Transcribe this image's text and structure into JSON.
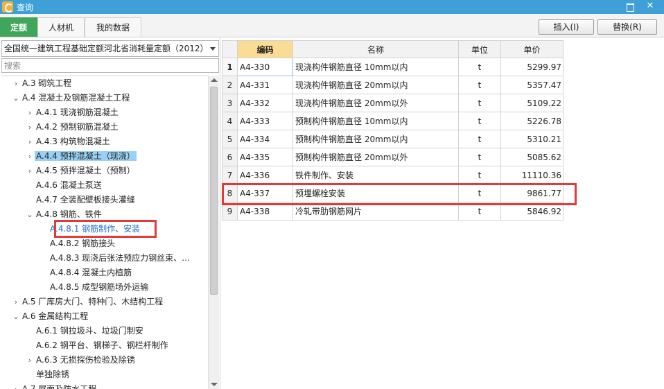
{
  "window": {
    "title": "查询",
    "close_glyph": "✕"
  },
  "tabs": [
    {
      "label": "定额",
      "active": true
    },
    {
      "label": "人材机",
      "active": false
    },
    {
      "label": "我的数据",
      "active": false
    }
  ],
  "actions": {
    "insert_label": "插入(I)",
    "replace_label": "替换(R)"
  },
  "left": {
    "quota_book": "全国统一建筑工程基础定额河北省消耗量定额（2012）",
    "search_placeholder": "搜索",
    "tree": [
      {
        "arrow": "›",
        "label": "A.3 砌筑工程",
        "level": 0
      },
      {
        "arrow": "⌄",
        "label": "A.4 混凝土及钢筋混凝土工程",
        "level": 0
      },
      {
        "arrow": "›",
        "label": "A.4.1 现浇钢筋混凝土",
        "level": 1
      },
      {
        "arrow": "›",
        "label": "A.4.2 预制钢筋混凝土",
        "level": 1
      },
      {
        "arrow": "›",
        "label": "A.4.3 构筑物混凝土",
        "level": 1
      },
      {
        "arrow": "›",
        "label": "A.4.4 预拌混凝土（现浇）",
        "level": 1,
        "selected": true
      },
      {
        "arrow": "›",
        "label": "A.4.5 预拌混凝土（预制）",
        "level": 1
      },
      {
        "arrow": "",
        "label": "A.4.6 混凝土泵送",
        "level": 1
      },
      {
        "arrow": "",
        "label": "A.4.7 全装配壁板接头灌缝",
        "level": 1
      },
      {
        "arrow": "⌄",
        "label": "A.4.8 钢筋、铁件",
        "level": 1
      },
      {
        "arrow": "",
        "label": "A.4.8.1 钢筋制作、安装",
        "level": 2,
        "link": true
      },
      {
        "arrow": "",
        "label": "A.4.8.2 钢筋接头",
        "level": 2
      },
      {
        "arrow": "",
        "label": "A.4.8.3 现浇后张法预应力钢丝束、…",
        "level": 2
      },
      {
        "arrow": "",
        "label": "A.4.8.4 混凝土内植筋",
        "level": 2
      },
      {
        "arrow": "",
        "label": "A.4.8.5 成型钢筋场外运输",
        "level": 2
      },
      {
        "arrow": "›",
        "label": "A.5 厂库房大门、特种门、木结构工程",
        "level": 0
      },
      {
        "arrow": "⌄",
        "label": "A.6 金属结构工程",
        "level": 0
      },
      {
        "arrow": "",
        "label": "A.6.1 钢拉圾斗、垃圾门制安",
        "level": 1
      },
      {
        "arrow": "",
        "label": "A.6.2 钢平台、钢梯子、钢栏杆制作",
        "level": 1
      },
      {
        "arrow": "›",
        "label": "A.6.3 无损探伤检验及除锈",
        "level": 1
      },
      {
        "arrow": "",
        "label": "单独除锈",
        "level": 1
      },
      {
        "arrow": "›",
        "label": "A.7 屋面及防水工程",
        "level": 0
      }
    ]
  },
  "grid": {
    "headers": {
      "rownum": "",
      "code": "编码",
      "name": "名称",
      "unit": "单位",
      "price": "单价"
    },
    "rows": [
      {
        "n": "1",
        "code": "A4-330",
        "name": "现浇构件钢筋直径 10mm以内",
        "unit": "t",
        "price": "5299.97",
        "current": true
      },
      {
        "n": "2",
        "code": "A4-331",
        "name": "现浇构件钢筋直径 20mm以内",
        "unit": "t",
        "price": "5357.47"
      },
      {
        "n": "3",
        "code": "A4-332",
        "name": "现浇构件钢筋直径 20mm以外",
        "unit": "t",
        "price": "5109.22"
      },
      {
        "n": "4",
        "code": "A4-333",
        "name": "预制构件钢筋直径 10mm以内",
        "unit": "t",
        "price": "5226.78"
      },
      {
        "n": "5",
        "code": "A4-334",
        "name": "预制构件钢筋直径 20mm以内",
        "unit": "t",
        "price": "5310.21"
      },
      {
        "n": "6",
        "code": "A4-335",
        "name": "预制构件钢筋直径 20mm以外",
        "unit": "t",
        "price": "5085.62"
      },
      {
        "n": "7",
        "code": "A4-336",
        "name": "铁件制作、安装",
        "unit": "t",
        "price": "11110.36"
      },
      {
        "n": "8",
        "code": "A4-337",
        "name": "预埋螺栓安装",
        "unit": "t",
        "price": "9861.77"
      },
      {
        "n": "9",
        "code": "A4-338",
        "name": "冷轧带肋钢筋网片",
        "unit": "t",
        "price": "5846.92"
      }
    ]
  },
  "colors": {
    "titlebar": "#3fa0d8",
    "active_tab": "#3fa65a",
    "highlight": "#e23a3a",
    "selected_row": "#99d1f5",
    "sorted_header": "#fbdc94"
  }
}
